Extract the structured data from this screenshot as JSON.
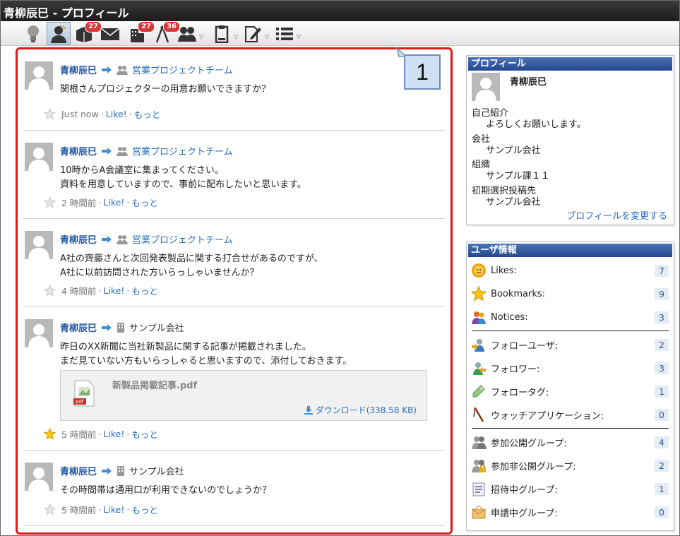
{
  "window": {
    "title": "青柳辰巳 - プロフィール"
  },
  "toolbar": {
    "badges": {
      "box": "27",
      "building": "27",
      "compass": "36"
    }
  },
  "callout": {
    "label": "1"
  },
  "posts": [
    {
      "author": "青柳辰巳",
      "target": "営業プロジェクトチーム",
      "target_type": "group",
      "lines": [
        "関根さんプロジェクターの用意お願いできますか？"
      ],
      "time": "Just now",
      "like": "Like!",
      "more": "もっと",
      "starred": false
    },
    {
      "author": "青柳辰巳",
      "target": "営業プロジェクトチーム",
      "target_type": "group",
      "lines": [
        "10時からA会議室に集まってください。",
        "資料を用意していますので、事前に配布したいと思います。"
      ],
      "time": "2 時間前",
      "like": "Like!",
      "more": "もっと",
      "starred": false
    },
    {
      "author": "青柳辰巳",
      "target": "営業プロジェクトチーム",
      "target_type": "group",
      "lines": [
        "A社の齊藤さんと次回発表製品に関する打合せがあるのですが、",
        "A社に以前訪問された方いらっしゃいませんか？"
      ],
      "time": "4 時間前",
      "like": "Like!",
      "more": "もっと",
      "starred": false
    },
    {
      "author": "青柳辰巳",
      "target": "サンプル会社",
      "target_type": "company",
      "lines": [
        "昨日のXX新聞に当社新製品に関する記事が掲載されました。",
        "まだ見ていない方もいらっしゃると思いますので、添付しておきます。"
      ],
      "attachment": {
        "name": "新製品掲載記事.pdf",
        "download": "ダウンロード(338.58 KB)"
      },
      "time": "5 時間前",
      "like": "Like!",
      "more": "もっと",
      "starred": true
    },
    {
      "author": "青柳辰巳",
      "target": "サンプル会社",
      "target_type": "company",
      "lines": [
        "その時間帯は通用口が利用できないのでしょうか？"
      ],
      "time": "5 時間前",
      "like": "Like!",
      "more": "もっと",
      "starred": false
    }
  ],
  "profile": {
    "heading": "プロフィール",
    "name": "青柳辰巳",
    "fields": [
      {
        "label": "自己紹介",
        "value": "よろしくお願いします。"
      },
      {
        "label": "会社",
        "value": "サンプル会社"
      },
      {
        "label": "組織",
        "value": "サンプル課１１"
      },
      {
        "label": "初期選択投稿先",
        "value": "サンプル会社"
      }
    ],
    "edit_link": "プロフィールを変更する"
  },
  "user_info": {
    "heading": "ユーザ情報",
    "stats": [
      {
        "label": "Likes:",
        "count": "7",
        "icon": "sun-face-icon"
      },
      {
        "label": "Bookmarks:",
        "count": "9",
        "icon": "star-icon"
      },
      {
        "label": "Notices:",
        "count": "3",
        "icon": "people-notice-icon"
      },
      {
        "label": "フォローユーザ:",
        "count": "2",
        "icon": "follow-user-icon"
      },
      {
        "label": "フォロワー:",
        "count": "3",
        "icon": "follower-icon"
      },
      {
        "label": "フォロータグ:",
        "count": "1",
        "icon": "tag-icon"
      },
      {
        "label": "ウォッチアプリケーション:",
        "count": "0",
        "icon": "watch-app-icon"
      },
      {
        "label": "参加公開グループ:",
        "count": "4",
        "icon": "public-group-icon"
      },
      {
        "label": "参加非公開グループ:",
        "count": "2",
        "icon": "private-group-icon"
      },
      {
        "label": "招待中グループ:",
        "count": "1",
        "icon": "invited-group-icon"
      },
      {
        "label": "申請中グループ:",
        "count": "0",
        "icon": "applying-group-icon"
      }
    ]
  },
  "colors": {
    "accent": "#2a6fba",
    "highlight_border": "#e01818",
    "panel_head": "#25478e"
  }
}
